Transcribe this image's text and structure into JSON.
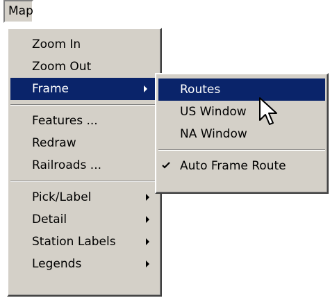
{
  "menubar": {
    "map_label": "Map"
  },
  "main_menu": {
    "items": [
      {
        "label": "Zoom In"
      },
      {
        "label": "Zoom Out"
      },
      {
        "label": "Frame"
      },
      {
        "label": "Features ..."
      },
      {
        "label": "Redraw"
      },
      {
        "label": "Railroads ..."
      },
      {
        "label": "Pick/Label"
      },
      {
        "label": "Detail"
      },
      {
        "label": "Station Labels"
      },
      {
        "label": "Legends"
      }
    ]
  },
  "frame_submenu": {
    "items": [
      {
        "label": "Routes"
      },
      {
        "label": "US Window"
      },
      {
        "label": "NA Window"
      },
      {
        "label": "Auto Frame Route",
        "checked": true
      }
    ]
  },
  "colors": {
    "menu_bg": "#d4d0c8",
    "highlight_bg": "#0a246a",
    "highlight_fg": "#ffffff"
  },
  "icons": {
    "check": "check-icon",
    "submenu_arrow": "submenu-arrow-icon",
    "cursor": "mouse-pointer-icon"
  }
}
